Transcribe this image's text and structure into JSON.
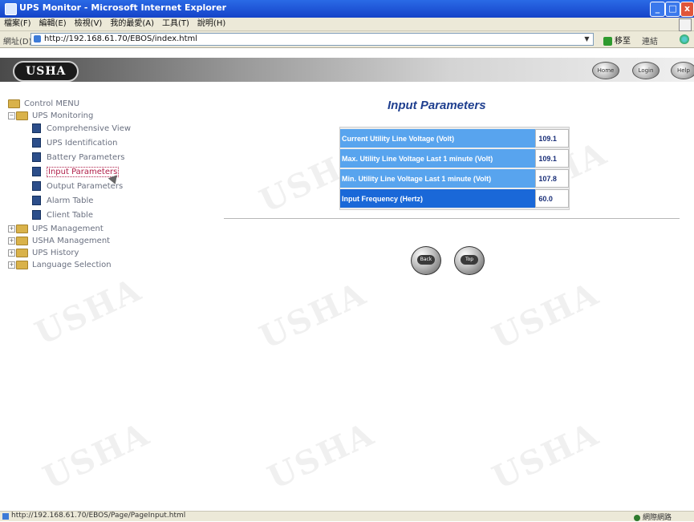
{
  "window": {
    "title": "UPS Monitor - Microsoft Internet Explorer",
    "controls": {
      "minimize": "_",
      "maximize": "□",
      "close": "x"
    }
  },
  "menubar": {
    "items": [
      "檔案(F)",
      "編輯(E)",
      "檢視(V)",
      "我的最愛(A)",
      "工具(T)",
      "說明(H)"
    ]
  },
  "addressbar": {
    "label": "網址(D)",
    "url": "http://192.168.61.70/EBOS/index.html",
    "go_label": "移至",
    "links_label": "連結"
  },
  "banner": {
    "logo": "USHA",
    "buttons": [
      {
        "icon": "home-icon",
        "label": "Home"
      },
      {
        "icon": "login-icon",
        "label": "Login"
      },
      {
        "icon": "help-icon",
        "label": "Help"
      }
    ]
  },
  "sidebar": {
    "root": "Control MENU",
    "ups_monitoring": {
      "label": "UPS Monitoring",
      "items": [
        "Comprehensive View",
        "UPS Identification",
        "Battery Parameters",
        "Input Parameters",
        "Output Parameters",
        "Alarm Table",
        "Client Table"
      ],
      "active_index": 3
    },
    "groups": [
      "UPS Management",
      "USHA Management",
      "UPS History",
      "Language Selection"
    ]
  },
  "main": {
    "title": "Input Parameters",
    "rows": [
      {
        "label": "Current Utility Line Voltage (Volt)",
        "value": "109.1"
      },
      {
        "label": "Max. Utility Line Voltage Last 1 minute (Volt)",
        "value": "109.1"
      },
      {
        "label": "Min. Utility Line Voltage Last 1 minute (Volt)",
        "value": "107.8"
      },
      {
        "label": "Input Frequency (Hertz)",
        "value": "60.0"
      }
    ],
    "buttons": {
      "back": "Back",
      "top": "Top"
    },
    "watermark": "USHA"
  },
  "statusbar": {
    "url": "http://192.168.61.70/EBOS/Page/PageInput.html",
    "zone": "網際網路"
  },
  "colors": {
    "label_cell": "#58a4ee",
    "label_cell_dark": "#1a68d8",
    "title": "#1f3f8f",
    "active_link": "#b0204a"
  }
}
